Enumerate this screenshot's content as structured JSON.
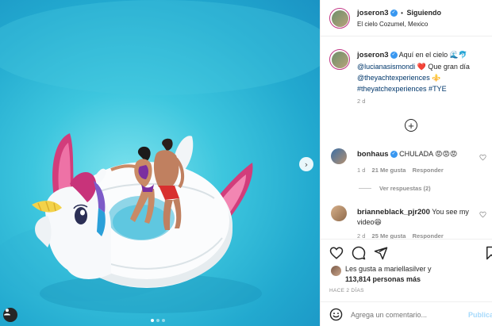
{
  "post": {
    "photo_alt": "",
    "carousel": {
      "total": 3,
      "active": 0
    }
  },
  "header": {
    "username": "joseron3",
    "separator": "•",
    "follow_status": "Siguiendo",
    "location": "El cielo Cozumel, Mexico"
  },
  "caption": {
    "username": "joseron3",
    "line1": "Aquí en el cielo 🌊🐬",
    "mention1": "@lucianasismondi",
    "line2": " ❤️ Que gran día",
    "mention2": "@theyachtexperiences",
    "emoji2": " ⚜️",
    "hashtags": "#theyatchexperiences #TYE",
    "time": "2 d"
  },
  "comments": [
    {
      "username": "bonhaus",
      "verified": true,
      "text": "CHULADA 😡😡😡",
      "time": "1 d",
      "likes": "21 Me gusta",
      "reply": "Responder",
      "view_replies": "Ver respuestas (2)"
    },
    {
      "username": "brianneblack_pjr200",
      "text": "You see my video😆",
      "time": "2 d",
      "likes": "25 Me gusta",
      "reply": "Responder"
    }
  ],
  "likes": {
    "line1": "Les gusta a mariellasilver y",
    "line2": "113,814 personas más"
  },
  "timestamp": "HACE 2 DÍAS",
  "add_comment": {
    "placeholder": "Agrega un comentario...",
    "publish": "Publicar"
  },
  "colors": {
    "accent_blue": "#0095f6",
    "verified_blue": "#3897f0",
    "link_blue": "#00376b"
  }
}
